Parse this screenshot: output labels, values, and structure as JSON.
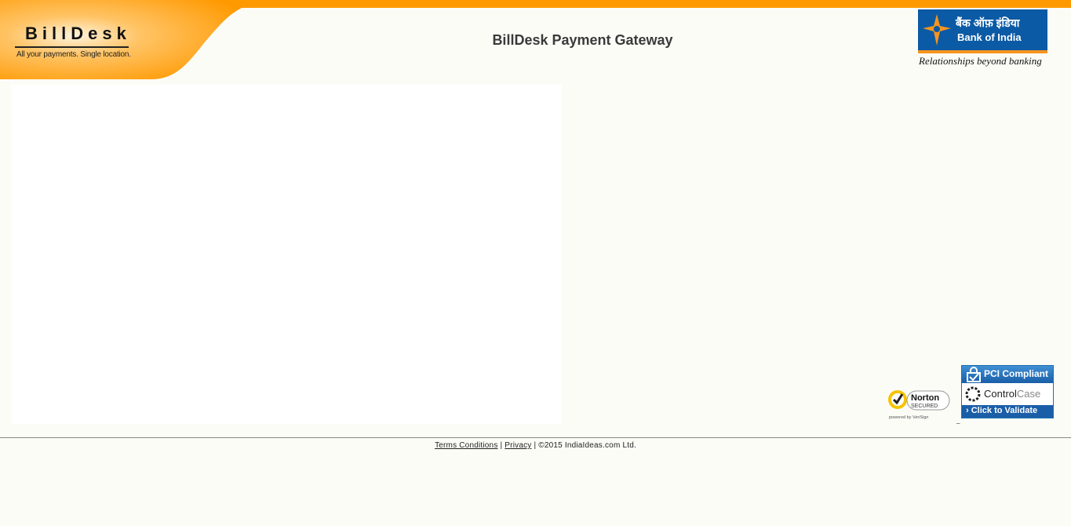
{
  "header": {
    "logo_text": "BillDesk",
    "logo_tagline": "All your payments. Single location.",
    "page_title": "BillDesk Payment Gateway",
    "bank": {
      "hindi_name": "बैंक ऑफ़ इंडिया",
      "name": "Bank of India",
      "tagline": "Relationships beyond banking"
    }
  },
  "badges": {
    "norton": {
      "title": "Norton",
      "subtitle": "SECURED",
      "powered_by": "powered by VeriSign"
    },
    "pci": {
      "top": "PCI Compliant",
      "brand_a": "Control",
      "brand_b": "Case",
      "cta": "Click to Validate"
    }
  },
  "footer": {
    "terms_label": "Terms Conditions",
    "separator": "|",
    "privacy_label": "Privacy",
    "copyright": "©2015 IndiaIdeas.com Ltd."
  },
  "colors": {
    "accent_orange": "#ff9900",
    "bank_blue": "#0b5aa5",
    "background": "#fcfcf7"
  }
}
